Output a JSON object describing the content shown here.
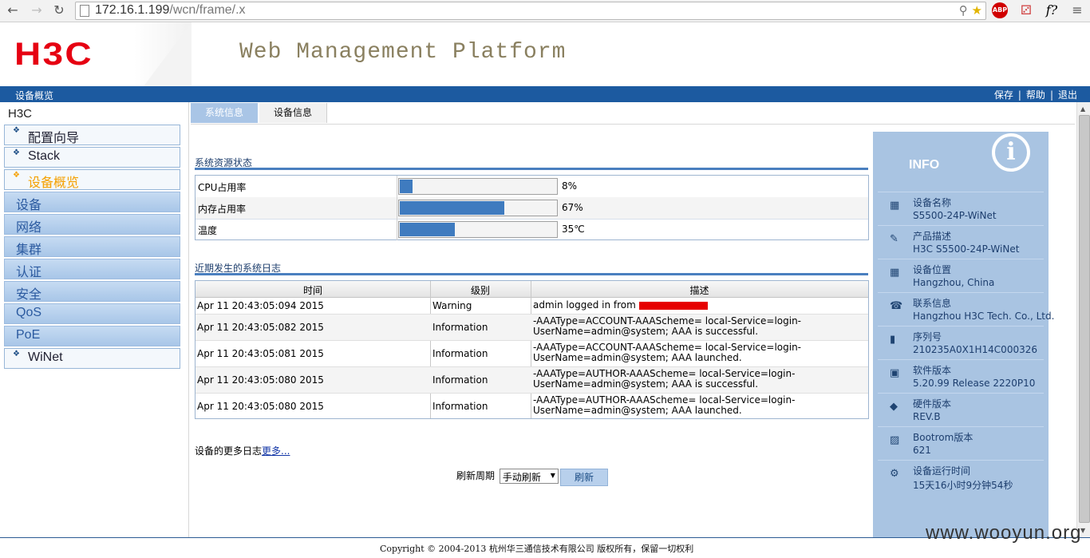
{
  "browser": {
    "url_host": "172.16.1.199",
    "url_path": "/wcn/frame/.x",
    "ext_abp": "ABP",
    "ext_f": "f?"
  },
  "header": {
    "logo": "H3C",
    "platform_title": "Web Management Platform"
  },
  "topbar": {
    "breadcrumb": "设备概览",
    "save": "保存",
    "help": "帮助",
    "logout": "退出"
  },
  "sidebar": {
    "root": "H3C",
    "items": [
      {
        "label": "配置向导"
      },
      {
        "label": "Stack"
      },
      {
        "label": "设备概览"
      },
      {
        "label": "设备"
      },
      {
        "label": "网络"
      },
      {
        "label": "集群"
      },
      {
        "label": "认证"
      },
      {
        "label": "安全"
      },
      {
        "label": "QoS"
      },
      {
        "label": "PoE"
      },
      {
        "label": "WiNet"
      }
    ]
  },
  "tabs": {
    "system_info": "系统信息",
    "device_info": "设备信息"
  },
  "resources": {
    "title": "系统资源状态",
    "rows": [
      {
        "name": "CPU占用率",
        "value": "8%",
        "fill": 0.08
      },
      {
        "name": "内存占用率",
        "value": "67%",
        "fill": 0.67
      },
      {
        "name": "温度",
        "value": "35℃",
        "fill": 0.35
      }
    ]
  },
  "logs": {
    "title": "近期发生的系统日志",
    "headers": {
      "time": "时间",
      "level": "级别",
      "desc": "描述"
    },
    "rows": [
      {
        "time": "Apr 11 20:43:05:094 2015",
        "level": "Warning",
        "desc": "admin logged in from"
      },
      {
        "time": "Apr 11 20:43:05:082 2015",
        "level": "Information",
        "desc": "-AAAType=ACCOUNT-AAAScheme= local-Service=login-UserName=admin@system; AAA is successful."
      },
      {
        "time": "Apr 11 20:43:05:081 2015",
        "level": "Information",
        "desc": "-AAAType=ACCOUNT-AAAScheme= local-Service=login-UserName=admin@system; AAA launched."
      },
      {
        "time": "Apr 11 20:43:05:080 2015",
        "level": "Information",
        "desc": "-AAAType=AUTHOR-AAAScheme= local-Service=login-UserName=admin@system; AAA is successful."
      },
      {
        "time": "Apr 11 20:43:05:080 2015",
        "level": "Information",
        "desc": "-AAAType=AUTHOR-AAAScheme= local-Service=login-UserName=admin@system; AAA launched."
      }
    ],
    "more_prefix": "设备的更多日志",
    "more_link": "更多..."
  },
  "refresh": {
    "label": "刷新周期",
    "selected": "手动刷新",
    "button": "刷新"
  },
  "info": {
    "title": "INFO",
    "items": [
      {
        "label": "设备名称",
        "value": "S5500-24P-WiNet",
        "icon": "device-icon"
      },
      {
        "label": "产品描述",
        "value": "H3C S5500-24P-WiNet",
        "icon": "product-icon"
      },
      {
        "label": "设备位置",
        "value": "Hangzhou, China",
        "icon": "location-icon"
      },
      {
        "label": "联系信息",
        "value": "Hangzhou H3C Tech. Co., Ltd.",
        "icon": "contact-icon"
      },
      {
        "label": "序列号",
        "value": "210235A0X1H14C000326",
        "icon": "serial-icon"
      },
      {
        "label": "软件版本",
        "value": "5.20.99 Release 2220P10",
        "icon": "software-icon"
      },
      {
        "label": "硬件版本",
        "value": "REV.B",
        "icon": "hardware-icon"
      },
      {
        "label": "Bootrom版本",
        "value": "621",
        "icon": "bootrom-icon"
      },
      {
        "label": "设备运行时间",
        "value": "15天16小时9分钟54秒",
        "icon": "uptime-icon"
      }
    ]
  },
  "footer": {
    "copyright": "Copyright © 2004-2013 杭州华三通信技术有限公司 版权所有，保留一切权利",
    "watermark": "www.wooyun.org"
  },
  "colors": {
    "brand_red": "#e60012",
    "nav_blue": "#1c5aa0",
    "bar_fill": "#3f7bbf",
    "info_panel": "#a9c4e2"
  }
}
